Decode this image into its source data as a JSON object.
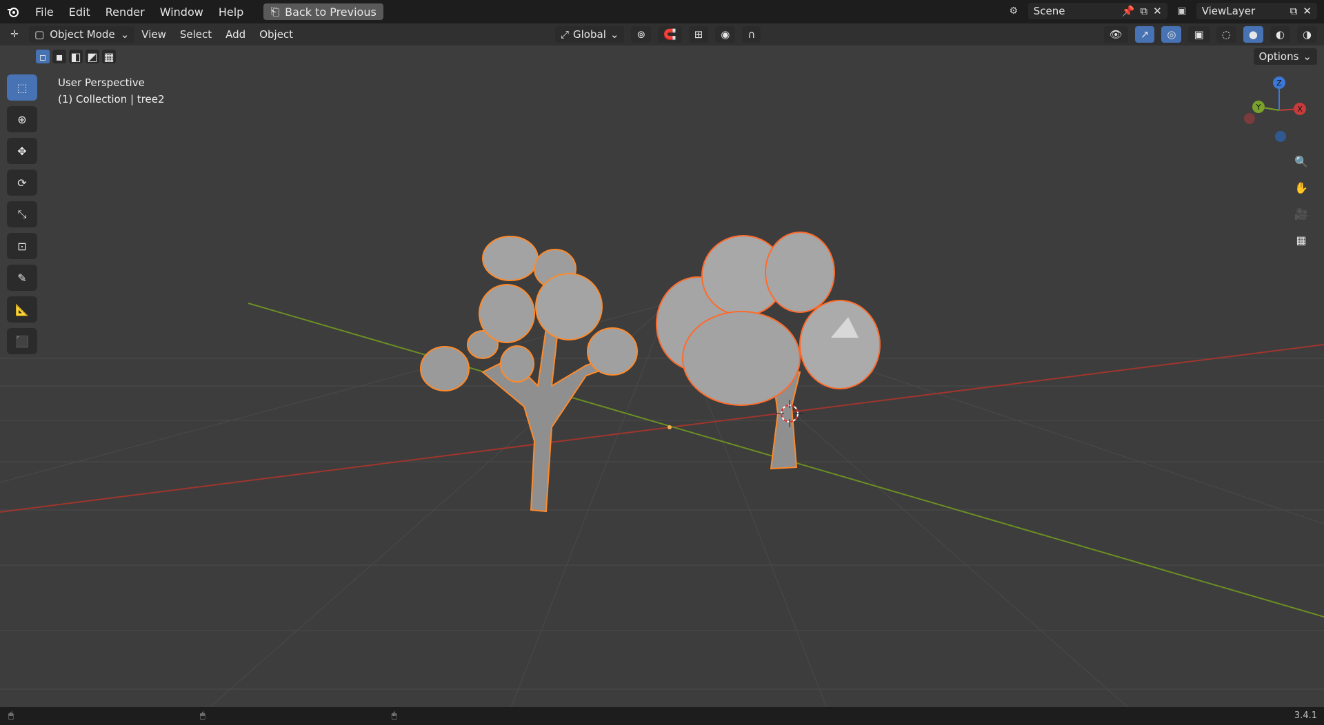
{
  "topbar": {
    "menus": [
      "File",
      "Edit",
      "Render",
      "Window",
      "Help"
    ],
    "back_label": "Back to Previous",
    "scene_label": "Scene",
    "viewlayer_label": "ViewLayer"
  },
  "header": {
    "mode_label": "Object Mode",
    "menus": [
      "View",
      "Select",
      "Add",
      "Object"
    ],
    "transform_orientation": "Global",
    "options_label": "Options"
  },
  "viewport": {
    "view_name": "User Perspective",
    "collection_info": "(1) Collection | tree2"
  },
  "gizmo": {
    "axes": [
      "Z",
      "Y",
      "X"
    ]
  },
  "status": {
    "version": "3.4.1"
  },
  "colors": {
    "bg": "#3d3d3d",
    "grid": "#4a4a4a",
    "x_axis": "#c0392b",
    "y_axis": "#6e9e23",
    "selected_outline": "#ff8a2a",
    "active_tool": "#4772b3"
  }
}
